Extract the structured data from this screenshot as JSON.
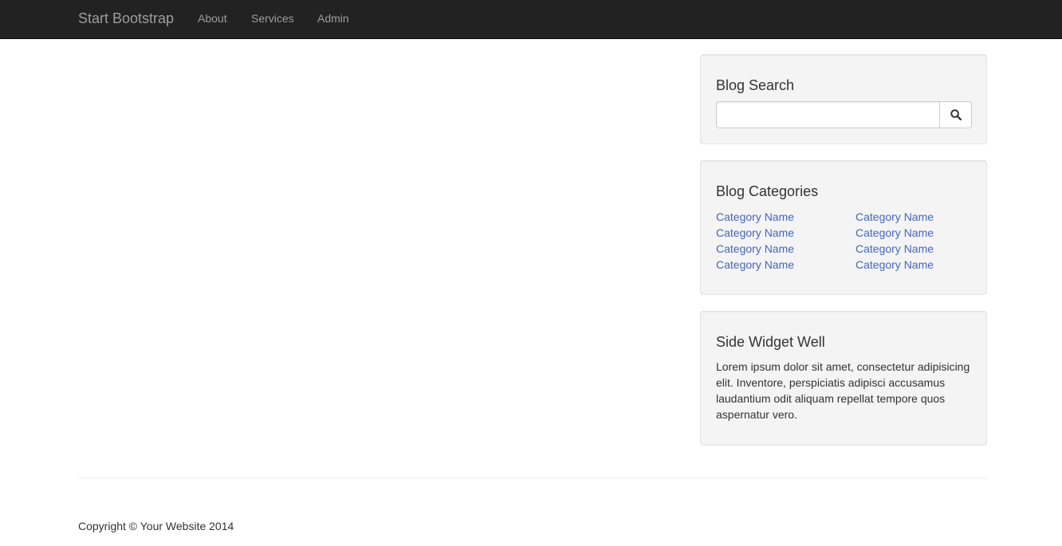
{
  "navbar": {
    "brand": "Start Bootstrap",
    "links": [
      "About",
      "Services",
      "Admin"
    ],
    "background": "#222222",
    "link_color": "#9d9d9d"
  },
  "sidebar": {
    "search": {
      "title": "Blog Search",
      "placeholder": "",
      "value": "",
      "button_icon": "search-icon"
    },
    "categories": {
      "title": "Blog Categories",
      "left": [
        "Category Name",
        "Category Name",
        "Category Name",
        "Category Name"
      ],
      "right": [
        "Category Name",
        "Category Name",
        "Category Name",
        "Category Name"
      ],
      "link_color": "#4466bb"
    },
    "widget": {
      "title": "Side Widget Well",
      "text": "Lorem ipsum dolor sit amet, consectetur adipisicing elit. Inventore, perspiciatis adipisci accusamus laudantium odit aliquam repellat tempore quos aspernatur vero."
    },
    "well_background": "#f4f4f4"
  },
  "footer": {
    "copyright": "Copyright © Your Website 2014"
  }
}
